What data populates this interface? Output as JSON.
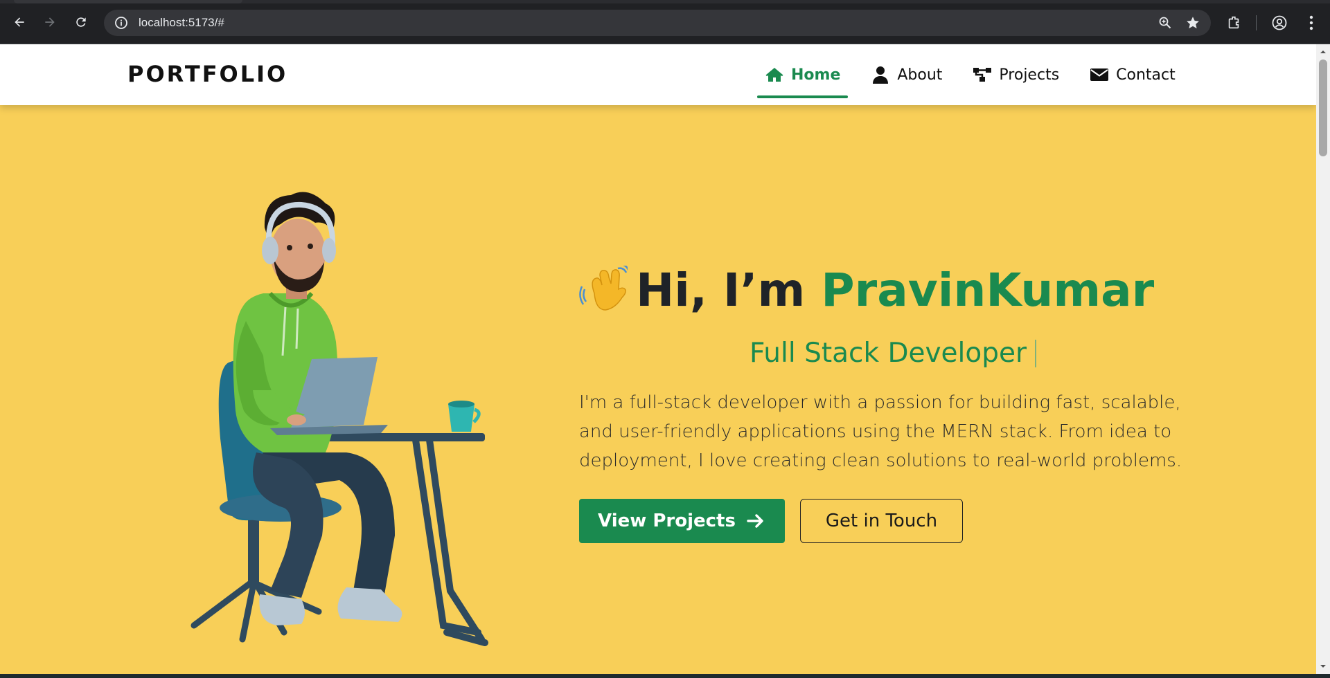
{
  "browser": {
    "url": "localhost:5173/#",
    "icons": [
      "back-icon",
      "forward-icon",
      "reload-icon",
      "site-info-icon",
      "zoom-icon",
      "bookmark-star-icon",
      "extensions-icon",
      "profile-icon",
      "menu-icon"
    ]
  },
  "navbar": {
    "logo": "PORTFOLIO",
    "links": [
      {
        "label": "Home",
        "icon": "home-icon",
        "active": true
      },
      {
        "label": "About",
        "icon": "user-icon",
        "active": false
      },
      {
        "label": "Projects",
        "icon": "sitemap-icon",
        "active": false
      },
      {
        "label": "Contact",
        "icon": "envelope-icon",
        "active": false
      }
    ]
  },
  "hero": {
    "greeting_prefix": "Hi, I’m",
    "name": "PravinKumar",
    "role": "Full Stack Developer",
    "bio": "I'm a full-stack developer with a passion for building fast, scalable, and user-friendly applications using the MERN stack. From idea to deployment, I love creating clean solutions to real-world problems.",
    "primary_button": "View Projects",
    "secondary_button": "Get in Touch"
  },
  "colors": {
    "accent": "#1a8a4f",
    "background": "#f8cf58",
    "text_dark": "#1f2328"
  }
}
